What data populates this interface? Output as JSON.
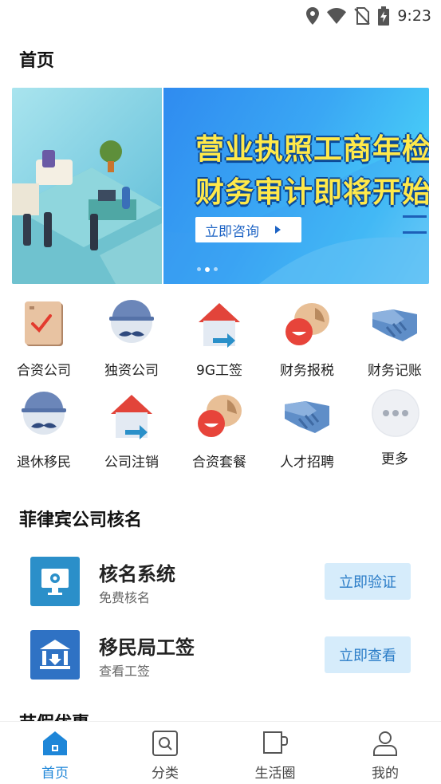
{
  "status_bar": {
    "time": "9:23",
    "icons": [
      "location-icon",
      "wifi-icon",
      "no-sim-icon",
      "battery-charging-icon"
    ]
  },
  "header": {
    "title": "首页"
  },
  "banner": {
    "headline_line1": "营业执照工商年检",
    "headline_line2": "财务审计即将开始",
    "cta_label": "立即咨询",
    "slide_count": 3,
    "active_slide": 2
  },
  "quick_menu": [
    {
      "label": "合资公司",
      "icon": "clipboard-check-icon"
    },
    {
      "label": "独资公司",
      "icon": "mustache-face-icon"
    },
    {
      "label": "9G工签",
      "icon": "house-arrow-icon"
    },
    {
      "label": "财务报税",
      "icon": "talk-face-icon"
    },
    {
      "label": "财务记账",
      "icon": "handshake-icon"
    },
    {
      "label": "退休移民",
      "icon": "mustache-face-icon"
    },
    {
      "label": "公司注销",
      "icon": "house-arrow-icon"
    },
    {
      "label": "合资套餐",
      "icon": "talk-face-icon"
    },
    {
      "label": "人才招聘",
      "icon": "handshake-icon"
    },
    {
      "label": "更多",
      "icon": "more-dots-icon"
    }
  ],
  "section": {
    "title": "菲律宾公司核名",
    "services": [
      {
        "title": "核名系统",
        "subtitle": "免费核名",
        "button": "立即验证",
        "icon": "monitor-gear-icon",
        "color": "#2b8fc9"
      },
      {
        "title": "移民局工签",
        "subtitle": "查看工签",
        "button": "立即查看",
        "icon": "government-building-icon",
        "color": "#2f72c4"
      }
    ]
  },
  "next_section_title": "节假优惠",
  "bottom_nav": [
    {
      "label": "首页",
      "icon": "home-icon",
      "active": true
    },
    {
      "label": "分类",
      "icon": "category-search-icon",
      "active": false
    },
    {
      "label": "生活圈",
      "icon": "cup-icon",
      "active": false
    },
    {
      "label": "我的",
      "icon": "user-icon",
      "active": false
    }
  ],
  "colors": {
    "accent": "#1e86d8",
    "button_bg": "#d6ecfb",
    "button_text": "#2a7cc7",
    "headline": "#ffe94a"
  }
}
